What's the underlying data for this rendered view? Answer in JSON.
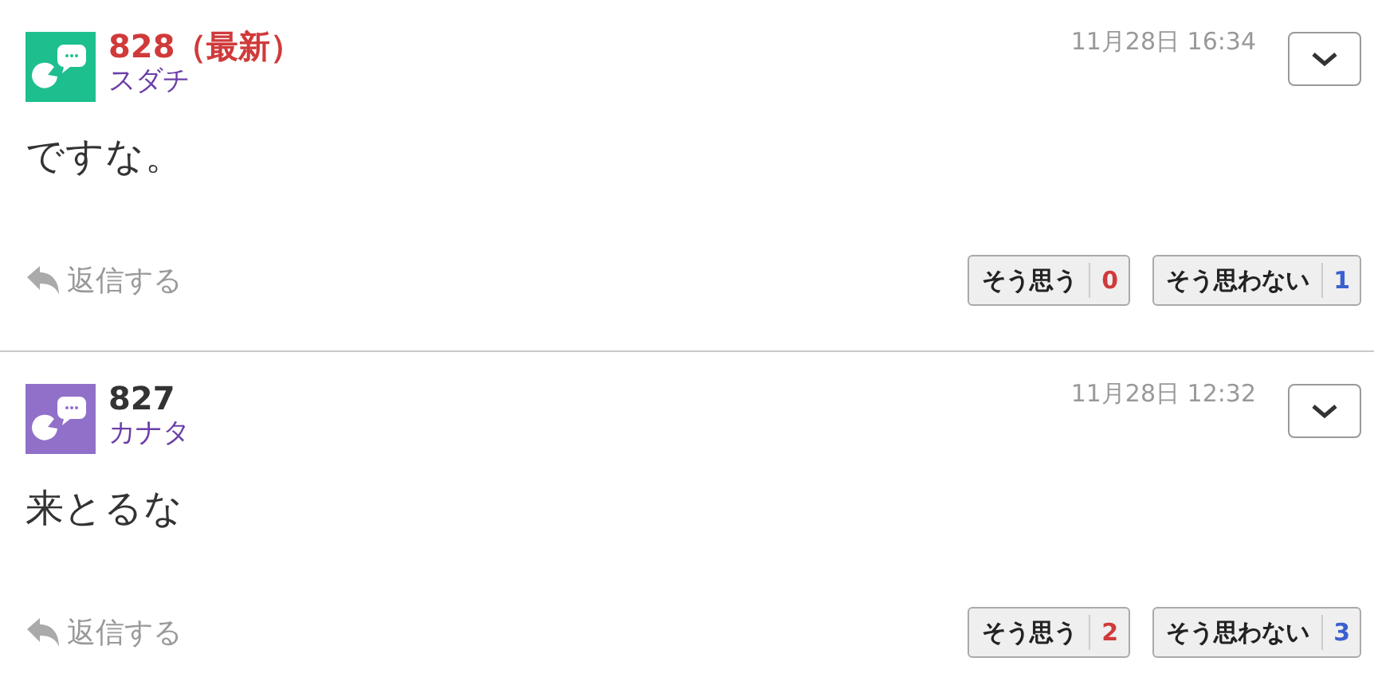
{
  "comments": [
    {
      "number": "828（最新）",
      "latest": true,
      "name": "スダチ",
      "color": "#1dbf8e",
      "date": "11月28日 16:34",
      "body": "ですな。",
      "reply": "返信する",
      "agree": {
        "label": "そう思う",
        "count": "0"
      },
      "disagree": {
        "label": "そう思わない",
        "count": "1"
      }
    },
    {
      "number": "827",
      "latest": false,
      "name": "カナタ",
      "color": "#9170c9",
      "date": "11月28日 12:32",
      "body": "来とるな",
      "reply": "返信する",
      "agree": {
        "label": "そう思う",
        "count": "2"
      },
      "disagree": {
        "label": "そう思わない",
        "count": "3"
      }
    }
  ]
}
